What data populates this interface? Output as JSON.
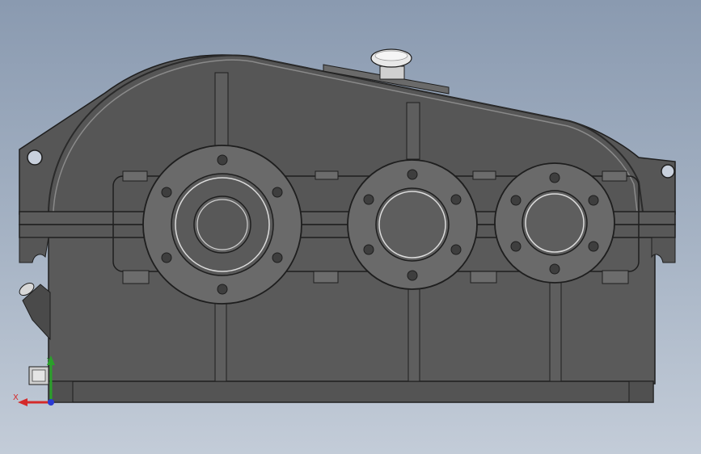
{
  "viewport": {
    "background_top": "#8a9ab0",
    "background_bottom": "#c3ccd8",
    "body_color": "#565656",
    "edge_color": "#1e1e1e",
    "flange_color": "#6a6a6a",
    "cap_color": "#e6e6e6"
  },
  "triad": {
    "x_label": "X",
    "y_label": "Y",
    "x_color": "#d42a2a",
    "y_color": "#2aa02a",
    "z_color": "#2a3ad4"
  }
}
